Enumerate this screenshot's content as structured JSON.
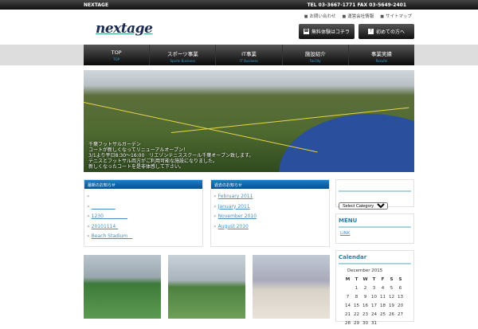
{
  "topbar": {
    "brand": "NEXTAGE",
    "contact": "TEL 03-3667-1771 FAX 03-5649-2401"
  },
  "header": {
    "logo": "nextage",
    "links": [
      "お問い合わせ",
      "運営会社情報",
      "サイトマップ"
    ],
    "buttons": [
      {
        "icon": "phone-icon",
        "label": "無料体験はコチラ"
      },
      {
        "icon": "question-icon",
        "label": "初めての方へ"
      }
    ]
  },
  "nav": [
    {
      "label": "TOP",
      "sub": "TOP"
    },
    {
      "label": "スポーツ事業",
      "sub": "Sports Business"
    },
    {
      "label": "IT事業",
      "sub": "IT Business"
    },
    {
      "label": "施設紹介",
      "sub": "Facility"
    },
    {
      "label": "事業実績",
      "sub": "Results"
    }
  ],
  "banner": {
    "lines": [
      "千葉フットサルガーデン",
      "コートが新しくなってリニューアルオープン！",
      "3/1より平日8:30～16:00　リエゾンテニススクール千葉オープン致します。",
      "テニスとフットサル両方がご利用可能な施設になりました。",
      "新しくなったコートを是非体感して下さい。"
    ]
  },
  "news": {
    "title": "最新のお知らせ",
    "items": [
      "",
      "__________",
      "1230__________",
      "20101114_",
      "Beach Stadium__"
    ]
  },
  "archive": {
    "title": "過去のお知らせ",
    "items": [
      "February 2011",
      "January 2011",
      "November 2010",
      "August 2010"
    ]
  },
  "sidebar": {
    "category_select": "Select Category",
    "menu_title": "MENU",
    "menu_items": [
      "LINK"
    ],
    "calendar": {
      "title": "Calendar",
      "month": "December 2015",
      "days": [
        "M",
        "T",
        "W",
        "T",
        "F",
        "S",
        "S"
      ],
      "weeks": [
        [
          "",
          "1",
          "2",
          "3",
          "4",
          "5",
          "6"
        ],
        [
          "7",
          "8",
          "9",
          "10",
          "11",
          "12",
          "13"
        ],
        [
          "14",
          "15",
          "16",
          "17",
          "18",
          "19",
          "20"
        ],
        [
          "21",
          "22",
          "23",
          "24",
          "25",
          "26",
          "27"
        ],
        [
          "28",
          "29",
          "30",
          "31",
          "",
          "",
          ""
        ]
      ]
    }
  }
}
